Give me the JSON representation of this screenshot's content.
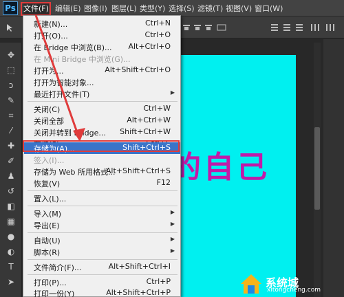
{
  "app": {
    "logo": "Ps"
  },
  "menubar": {
    "items": [
      "文件(F)",
      "编辑(E)",
      "图像(I)",
      "图层(L)",
      "类型(Y)",
      "选择(S)",
      "滤镜(T)",
      "视图(V)",
      "窗口(W)"
    ]
  },
  "canvas": {
    "text": "的自己",
    "bg_color": "#00f0f0",
    "text_color": "#c21aa8"
  },
  "file_menu": {
    "items": [
      {
        "label": "新建(N)...",
        "shortcut": "Ctrl+N"
      },
      {
        "label": "打开(O)...",
        "shortcut": "Ctrl+O"
      },
      {
        "label": "在 Bridge 中浏览(B)...",
        "shortcut": "Alt+Ctrl+O"
      },
      {
        "label": "在 Mini Bridge 中浏览(G)...",
        "shortcut": ""
      },
      {
        "label": "打开为...",
        "shortcut": "Alt+Shift+Ctrl+O"
      },
      {
        "label": "打开为智能对象...",
        "shortcut": ""
      },
      {
        "label": "最近打开文件(T)",
        "shortcut": ""
      },
      {
        "label": "关闭(C)",
        "shortcut": "Ctrl+W"
      },
      {
        "label": "关闭全部",
        "shortcut": "Alt+Ctrl+W"
      },
      {
        "label": "关闭并转到 Bridge...",
        "shortcut": "Shift+Ctrl+W"
      },
      {
        "label": "存储(S)",
        "shortcut": "Ctrl+S"
      },
      {
        "label": "存储为(A)...",
        "shortcut": "Shift+Ctrl+S"
      },
      {
        "label": "签入(I)...",
        "shortcut": ""
      },
      {
        "label": "存储为 Web 所用格式...",
        "shortcut": "Alt+Shift+Ctrl+S"
      },
      {
        "label": "恢复(V)",
        "shortcut": "F12"
      },
      {
        "label": "置入(L)...",
        "shortcut": ""
      },
      {
        "label": "导入(M)",
        "shortcut": ""
      },
      {
        "label": "导出(E)",
        "shortcut": ""
      },
      {
        "label": "自动(U)",
        "shortcut": ""
      },
      {
        "label": "脚本(R)",
        "shortcut": ""
      },
      {
        "label": "文件简介(F)...",
        "shortcut": "Alt+Shift+Ctrl+I"
      },
      {
        "label": "打印(P)...",
        "shortcut": "Ctrl+P"
      },
      {
        "label": "打印一份(Y)",
        "shortcut": "Alt+Shift+Ctrl+P"
      }
    ]
  },
  "watermark": {
    "text": "系统城",
    "url": "xitongcheng.com"
  },
  "colors": {
    "highlight": "#e03b3b",
    "menu_selected": "#3a74c9"
  }
}
